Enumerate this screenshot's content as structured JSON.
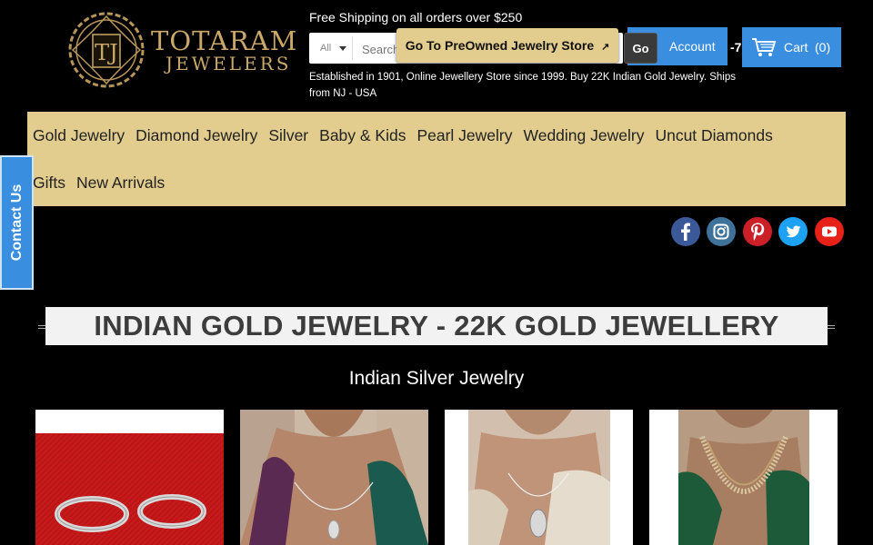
{
  "brand": {
    "line1": "TOTARAM",
    "line2": "JEWELERS",
    "monogram": "TJ"
  },
  "header": {
    "shipping_text": "Free Shipping on all orders over $250",
    "search": {
      "category_selected": "All",
      "placeholder": "Search"
    },
    "preowned_label": "Go To PreOwned Jewelry Store",
    "go_label": "Go",
    "account_label": "Account",
    "phone_fragment": "-7",
    "cart_label": "Cart",
    "cart_count": "(0)",
    "established_text": "Established in 1901, Online Jewellery Store since 1999. Buy 22K Indian Gold Jewelry. Ships from NJ - USA"
  },
  "nav": {
    "row1": [
      "Gold Jewelry",
      "Diamond Jewelry",
      "Silver",
      "Baby & Kids",
      "Pearl Jewelry",
      "Wedding Jewelry",
      "Uncut Diamonds"
    ],
    "row2": [
      "Gifts",
      "New Arrivals"
    ]
  },
  "contact_tab_label": "Contact Us",
  "social": [
    {
      "name": "facebook-icon",
      "color": "#3b5998"
    },
    {
      "name": "instagram-icon",
      "color": "#3f729b"
    },
    {
      "name": "pinterest-icon",
      "color": "#cb2027"
    },
    {
      "name": "twitter-icon",
      "color": "#1da1f2"
    },
    {
      "name": "youtube-icon",
      "color": "#e62117"
    }
  ],
  "main": {
    "title": "INDIAN GOLD JEWELRY - 22K GOLD JEWELLERY",
    "subtitle": "Indian Silver Jewelry"
  },
  "colors": {
    "accent_gold": "#e2cd8e",
    "accent_blue": "#3a8ee0",
    "background": "#000000"
  }
}
